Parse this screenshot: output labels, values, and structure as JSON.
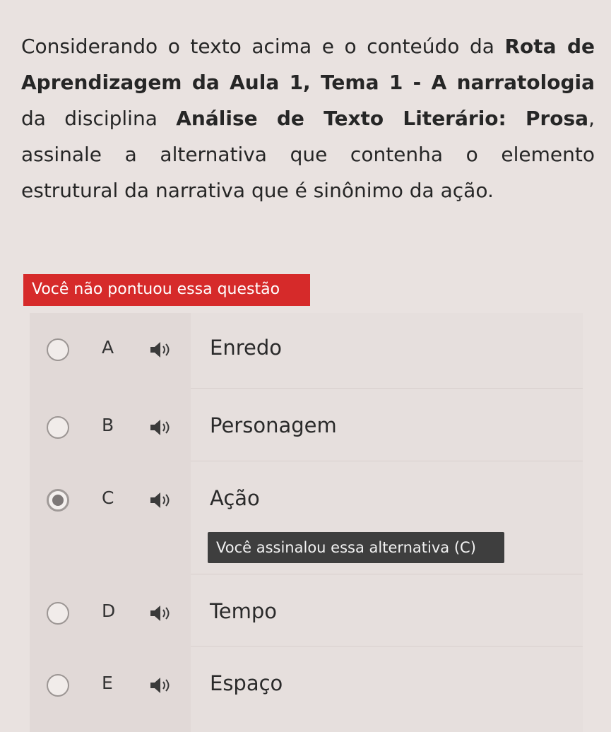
{
  "question": {
    "part1": "Considerando o texto acima e o conteúdo da ",
    "bold1": "Rota de Aprendizagem da Aula 1, Tema 1 - A narratologia",
    "part2": " da disciplina ",
    "bold2": "Análise de Texto Literário: Prosa",
    "part3": ", assinale a alternativa que contenha o elemento estrutural da narrativa que é sinônimo da ação."
  },
  "score_banner": "Você não pontuou essa questão",
  "options": [
    {
      "letter": "A",
      "text": "Enredo",
      "selected": false,
      "icon": "speaker-icon"
    },
    {
      "letter": "B",
      "text": "Personagem",
      "selected": false,
      "icon": "speaker-icon"
    },
    {
      "letter": "C",
      "text": "Ação",
      "selected": true,
      "icon": "speaker-icon"
    },
    {
      "letter": "D",
      "text": "Tempo",
      "selected": false,
      "icon": "speaker-icon"
    },
    {
      "letter": "E",
      "text": "Espaço",
      "selected": false,
      "icon": "speaker-icon"
    }
  ],
  "selected_note": "Você assinalou essa alternativa (C)",
  "colors": {
    "banner_red": "#d62a2a",
    "note_dark": "#3e3e3e",
    "background": "#e9e2e0"
  }
}
